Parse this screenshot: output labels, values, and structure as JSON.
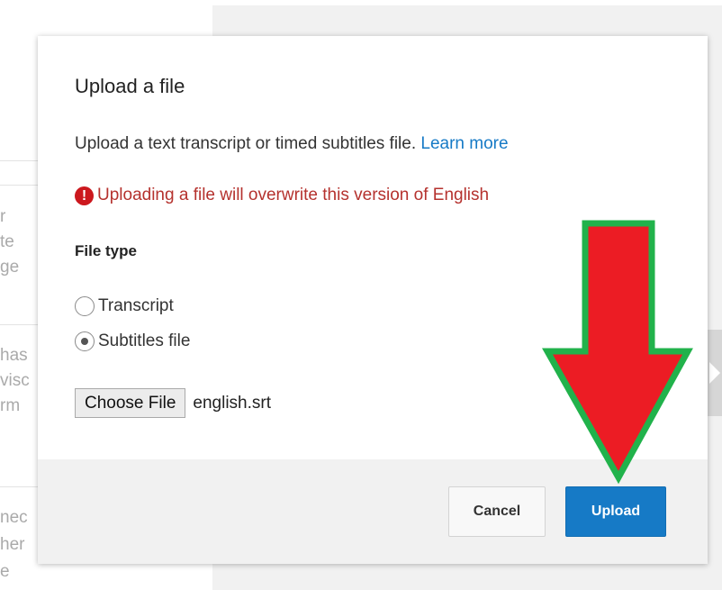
{
  "background": {
    "fragments": [
      "r",
      "te",
      "ge",
      "has",
      "visc",
      "rm",
      "nec",
      "her",
      "e"
    ]
  },
  "dialog": {
    "title": "Upload a file",
    "description": "Upload a text transcript or timed subtitles file.",
    "learn_more": "Learn more",
    "warning_icon": "!",
    "warning_text": "Uploading a file will overwrite this version of English",
    "file_type_label": "File type",
    "options": [
      {
        "label": "Transcript",
        "checked": false
      },
      {
        "label": "Subtitles file",
        "checked": true
      }
    ],
    "choose_file_label": "Choose File",
    "file_name": "english.srt",
    "cancel_label": "Cancel",
    "upload_label": "Upload"
  },
  "colors": {
    "link": "#167ac6",
    "warning": "#b5322e",
    "primary_button": "#167ac6",
    "arrow_fill": "#ec1c24",
    "arrow_outline": "#21b24b"
  }
}
